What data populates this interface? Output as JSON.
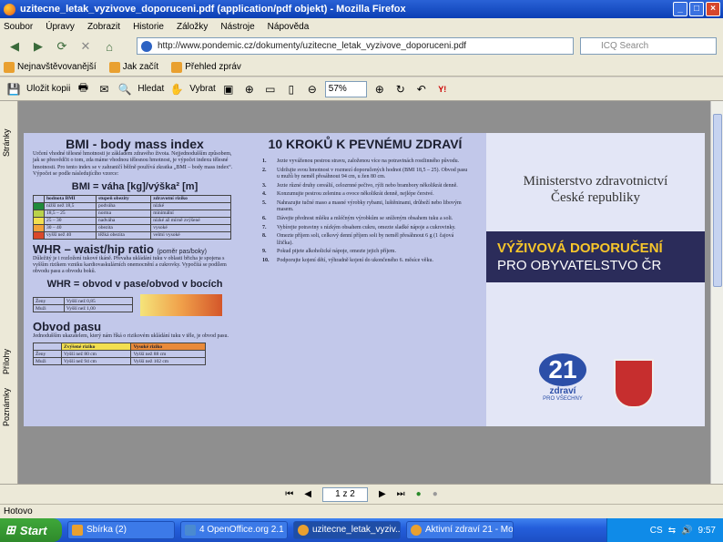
{
  "window": {
    "title": "uzitecne_letak_vyzivove_doporuceni.pdf (application/pdf objekt) - Mozilla Firefox"
  },
  "menu": [
    "Soubor",
    "Úpravy",
    "Zobrazit",
    "Historie",
    "Záložky",
    "Nástroje",
    "Nápověda"
  ],
  "nav": {
    "url": "http://www.pondemic.cz/dokumenty/uzitecne_letak_vyzivove_doporuceni.pdf",
    "search_placeholder": "ICQ Search"
  },
  "bookmarks": [
    "Nejnavštěvovanější",
    "Jak začít",
    "Přehled zpráv"
  ],
  "pdf_toolbar": {
    "save": "Uložit kopii",
    "search": "Hledat",
    "select": "Vybrat",
    "zoom": "57%"
  },
  "side_tabs": [
    "Stránky",
    "Přílohy",
    "Poznámky"
  ],
  "page_indicator": "1 z 2",
  "status": "Hotovo",
  "taskbar": {
    "start": "Start",
    "tasks": [
      "Sbírka (2)",
      "4 OpenOffice.org 2.1",
      "uzitecne_letak_vyziv...",
      "Aktivní zdraví 21 - Mo..."
    ],
    "lang": "CS",
    "clock": "9:57"
  },
  "leaflet": {
    "bmi_title": "BMI - body mass index",
    "bmi_text": "Určení vhodné tělesné hmotnosti je základem zdravého života. Nejjednodušším způsobem, jak se přesvědčit o tom, zda máme vhodnou tělesnou hmotnost, je výpočet indexu tělesné hmotnosti. Pro tento index se v zahraničí běžně používá zkratka „BMI – body mass index“.",
    "bmi_formula_intro": "Výpočet se podle následujícího vzorce:",
    "bmi_formula": "BMI = váha [kg]/výška² [m]",
    "bmi_table": {
      "headers": [
        "hodnota BMI",
        "stupeň obezity",
        "zdravotní riziko"
      ],
      "rows": [
        [
          "nižší než 18,5",
          "podváha",
          "nízké"
        ],
        [
          "18,5 – 25",
          "norma",
          "minimální"
        ],
        [
          "25 – 30",
          "nadváha",
          "nízké až mírně zvýšené"
        ],
        [
          "30 – 40",
          "obezita",
          "vysoké"
        ],
        [
          "vyšší než 40",
          "těžká obezita",
          "velmi vysoké"
        ]
      ]
    },
    "whr_title": "WHR – waist/hip ratio",
    "whr_sub": "(poměr pas/boky)",
    "whr_text": "Důležitý je i rozložení tukové tkáně. Převaha ukládání tuku v oblasti břicha je spojena s vyšším rizikem vzniku kardiovaskulárních onemocnění a cukrovky. Vypočítá se podílem obvodu pasu a obvodu boků.",
    "whr_formula": "WHR = obvod v pase/obvod v bocích",
    "whr_table": {
      "rows": [
        [
          "Ženy",
          "Vyšší než 0,85"
        ],
        [
          "Muži",
          "Vyšší než 1,00"
        ]
      ]
    },
    "waist_title": "Obvod pasu",
    "waist_text": "Jednodušším ukazatelem, který nám říká o rizikovém ukládání tuku v těle, je obvod pasu.",
    "waist_table": {
      "headers": [
        "",
        "Zvýšené riziko",
        "Vysoké riziko"
      ],
      "rows": [
        [
          "Ženy",
          "Vyšší než 80 cm",
          "Vyšší než 88 cm"
        ],
        [
          "Muži",
          "Vyšší než 94 cm",
          "Vyšší než 102 cm"
        ]
      ]
    },
    "steps_title": "10 KROKŮ K PEVNÉMU ZDRAVÍ",
    "steps": [
      "Jezte vyváženou pestrou stravu, založenou více na potravinách rostlinného původu.",
      "Udržujte svou hmotnost v rozmezí doporučených hodnot (BMI 18,5 – 25). Obvod pasu u mužů by neměl přesáhnout 94 cm, u žen 80 cm.",
      "Jezte různé druhy cereálií, celozrnné pečivo, rýži nebo brambory několikrát denně.",
      "Konzumujte pestrou zeleninu a ovoce několikrát denně, nejlépe čerstvé.",
      "Nahrazujte tučné maso a masné výrobky rybami, luštěninami, drůbeží nebo libovým masem.",
      "Dávejte přednost mléku a mléčným výrobkům se sníženým obsahem tuku a soli.",
      "Vybírejte potraviny s nízkým obsahem cukru, omezte sladké nápoje a cukrovinky.",
      "Omezte příjem soli, celkový denní příjem soli by neměl přesáhnout 6 g (1 čajová lžička).",
      "Pokud pijete alkoholické nápoje, omezte jejich příjem.",
      "Podporujte kojení dětí, výhradně kojení do ukončeného 6. měsíce věku."
    ],
    "ministry": [
      "Ministerstvo zdravotnictví",
      "České republiky"
    ],
    "band_line1": "VÝŽIVOVÁ DOPORUČENÍ",
    "band_line2": "PRO OBYVATELSTVO ČR",
    "logo_num": "21",
    "logo_text": "zdraví",
    "logo_sub": "PRO VŠECHNY"
  }
}
